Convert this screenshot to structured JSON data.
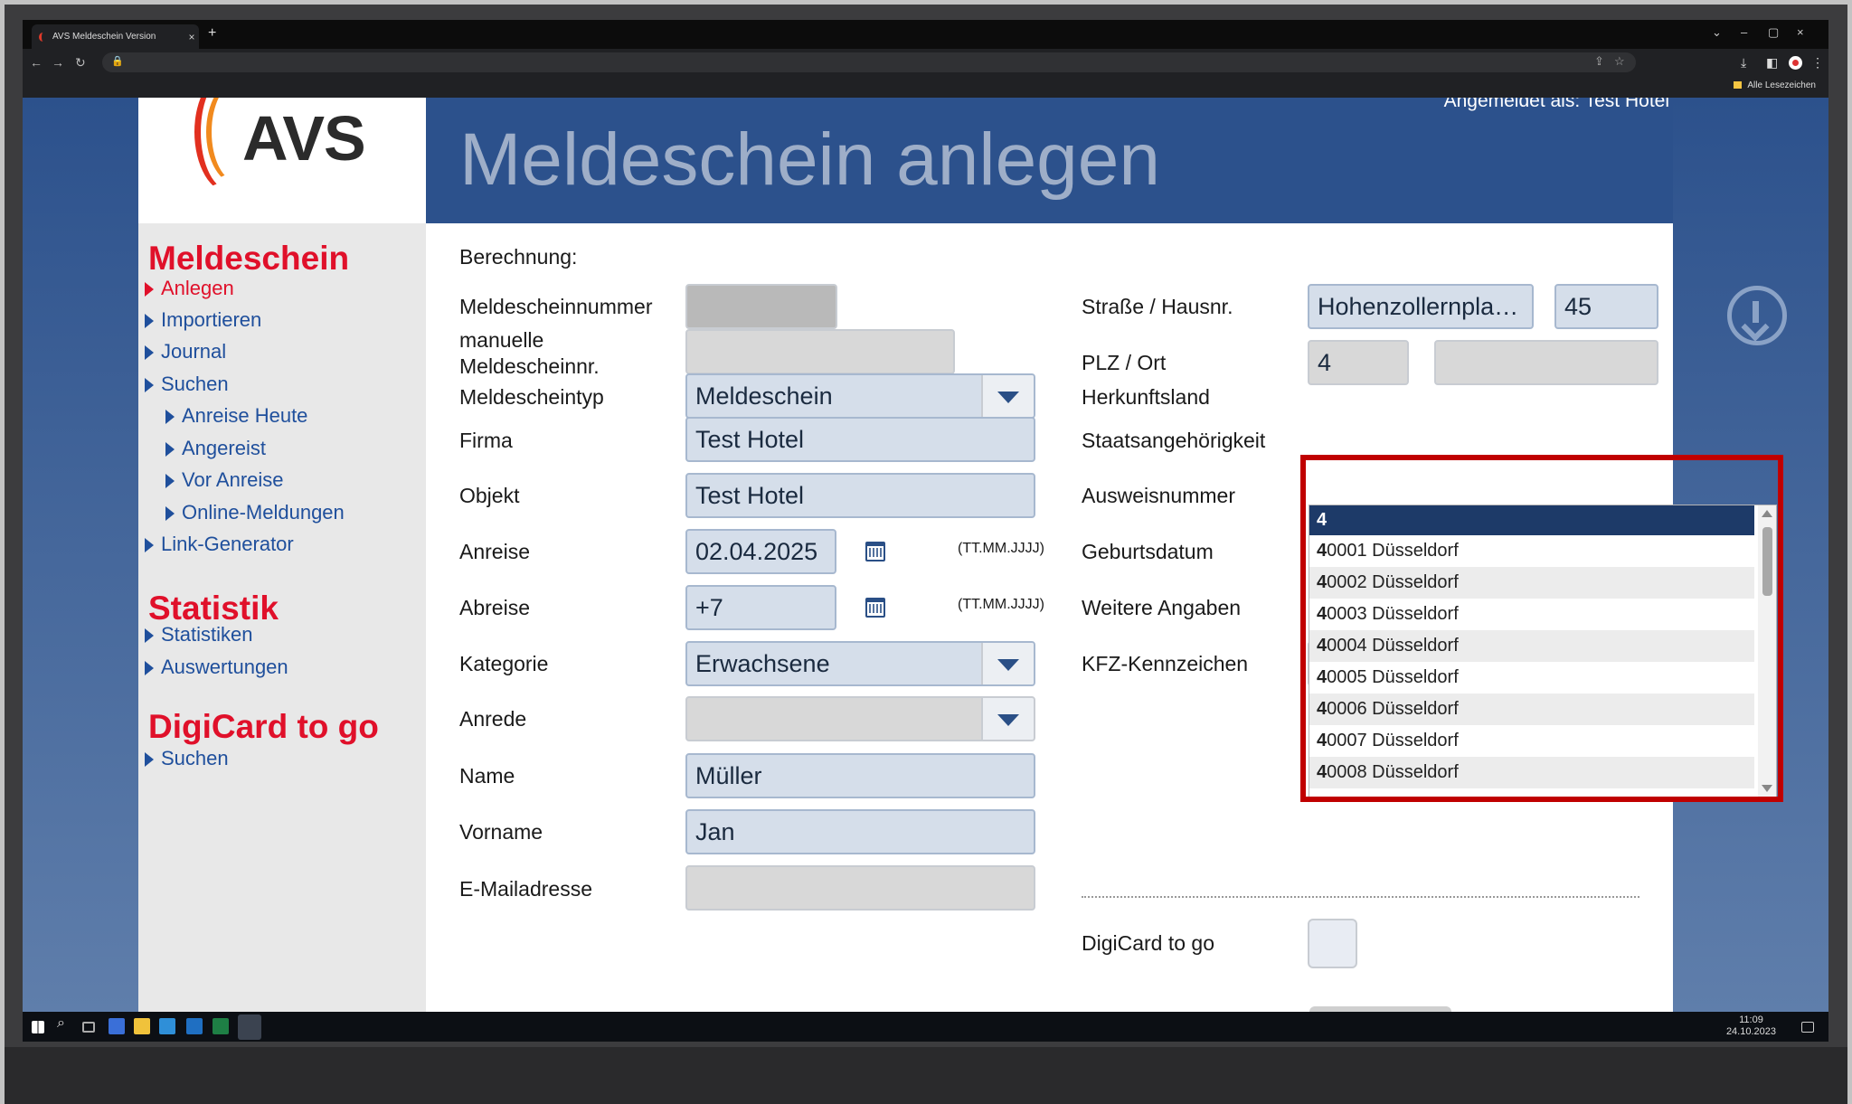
{
  "browser": {
    "tab_title": "AVS Meldeschein Version",
    "tab_close": "×",
    "new_tab": "+",
    "bookmarks_label": "Alle Lesezeichen",
    "window_controls": [
      "⌄",
      "–",
      "▢",
      "×"
    ]
  },
  "header": {
    "logo": "AVS",
    "logged_in": "Angemeldet als: Test Hotel",
    "title": "Meldeschein anlegen"
  },
  "sidebar": {
    "section1": "Meldeschein",
    "items1": [
      "Anlegen",
      "Importieren",
      "Journal",
      "Suchen"
    ],
    "subitems": [
      "Anreise Heute",
      "Angereist",
      "Vor Anreise",
      "Online-Meldungen"
    ],
    "item_link": "Link-Generator",
    "section2": "Statistik",
    "items2": [
      "Statistiken",
      "Auswertungen"
    ],
    "section3": "DigiCard to go",
    "items3": [
      "Suchen"
    ]
  },
  "form": {
    "berechnung": "Berechnung:",
    "meldescheinnummer": {
      "label": "Meldescheinnummer",
      "value": ""
    },
    "manuelle": {
      "label1": "manuelle",
      "label2": "Meldescheinnr.",
      "value": ""
    },
    "meldescheintyp": {
      "label": "Meldescheintyp",
      "value": "Meldeschein"
    },
    "firma": {
      "label": "Firma",
      "value": "Test Hotel"
    },
    "objekt": {
      "label": "Objekt",
      "value": "Test Hotel"
    },
    "anreise": {
      "label": "Anreise",
      "value": "02.04.2025",
      "hint": "(TT.MM.JJJJ)"
    },
    "abreise": {
      "label": "Abreise",
      "value": "+7",
      "hint": "(TT.MM.JJJJ)"
    },
    "kategorie": {
      "label": "Kategorie",
      "value": "Erwachsene"
    },
    "anrede": {
      "label": "Anrede",
      "value": ""
    },
    "name": {
      "label": "Name",
      "value": "Müller"
    },
    "vorname": {
      "label": "Vorname",
      "value": "Jan"
    },
    "email": {
      "label": "E-Mailadresse",
      "value": ""
    },
    "strasse": {
      "label": "Straße / Hausnr.",
      "value": "Hohenzollernpla…",
      "hausnr": "45"
    },
    "plz": {
      "label": "PLZ / Ort",
      "value": "4",
      "ort": ""
    },
    "herkunft": "Herkunftsland",
    "staat": "Staatsangehörigkeit",
    "ausweis": "Ausweisnummer",
    "geburt": "Geburtsdatum",
    "weitere": "Weitere Angaben",
    "kfz": {
      "label": "KFZ-Kennzeichen",
      "value": ""
    },
    "digicard": "DigiCard to go"
  },
  "plz_dropdown": {
    "header": "4",
    "items": [
      {
        "b": "4",
        "r": "0001 Düsseldorf"
      },
      {
        "b": "4",
        "r": "0002 Düsseldorf"
      },
      {
        "b": "4",
        "r": "0003 Düsseldorf"
      },
      {
        "b": "4",
        "r": "0004 Düsseldorf"
      },
      {
        "b": "4",
        "r": "0005 Düsseldorf"
      },
      {
        "b": "4",
        "r": "0006 Düsseldorf"
      },
      {
        "b": "4",
        "r": "0007 Düsseldorf"
      },
      {
        "b": "4",
        "r": "0008 Düsseldorf"
      }
    ]
  },
  "taskbar": {
    "time": "11:09",
    "date": "24.10.2023"
  },
  "colors": {
    "accent_red": "#e0102a",
    "nav_blue": "#1f4f9c",
    "header_blue": "#2c518c",
    "highlight_box": "#c00000"
  }
}
